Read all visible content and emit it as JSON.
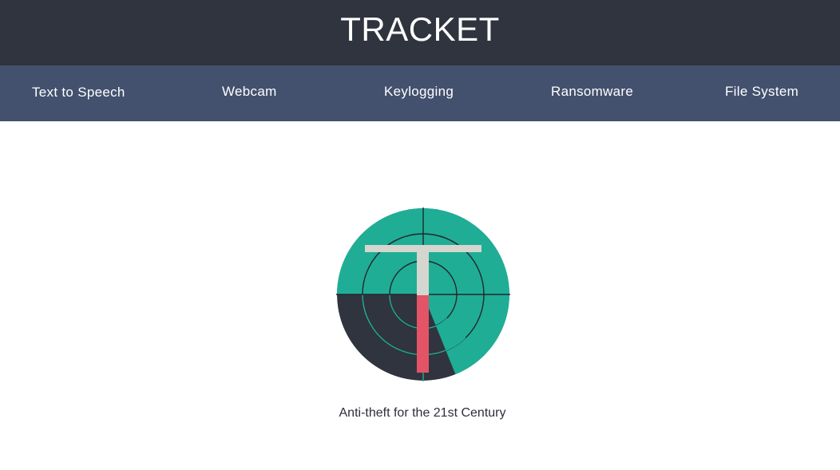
{
  "header": {
    "title": "TRACKET"
  },
  "nav": {
    "items": [
      {
        "label": "Text to Speech"
      },
      {
        "label": "Webcam"
      },
      {
        "label": "Keylogging"
      },
      {
        "label": "Ransomware"
      },
      {
        "label": "File System"
      }
    ]
  },
  "main": {
    "logo": {
      "icon": "radar-t-logo-icon",
      "colors": {
        "teal": "#1fae95",
        "dark": "#30343f",
        "letter": "#d5d6cf",
        "red": "#e25466"
      }
    },
    "tagline": "Anti-theft for the 21st Century"
  },
  "colors": {
    "header_bg": "#30343f",
    "nav_bg": "#43516e",
    "page_bg": "#ffffff"
  }
}
